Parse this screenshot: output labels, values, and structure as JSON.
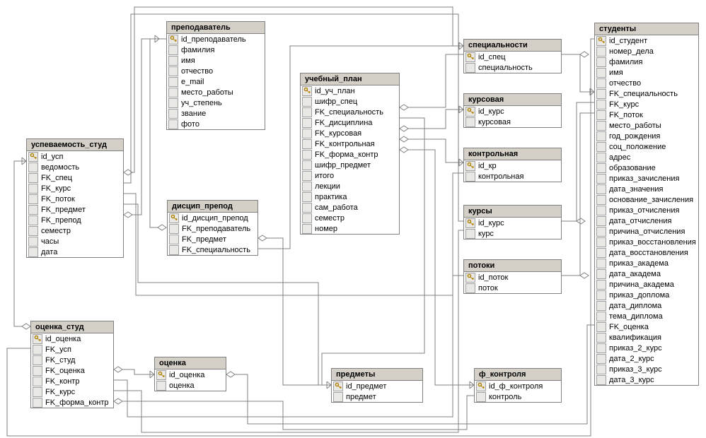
{
  "tables": {
    "uspevaemost": {
      "title": "успеваемость_студ",
      "fields": [
        {
          "name": "id_усп",
          "pk": true
        },
        {
          "name": "ведомость"
        },
        {
          "name": "FK_спец"
        },
        {
          "name": "FK_курс"
        },
        {
          "name": "FK_поток"
        },
        {
          "name": "FK_предмет"
        },
        {
          "name": "FK_препод"
        },
        {
          "name": "семестр"
        },
        {
          "name": "часы"
        },
        {
          "name": "дата"
        }
      ]
    },
    "prepod": {
      "title": "преподаватель",
      "fields": [
        {
          "name": "id_преподаватель",
          "pk": true
        },
        {
          "name": "фамилия"
        },
        {
          "name": "имя"
        },
        {
          "name": "отчество"
        },
        {
          "name": "e_mail"
        },
        {
          "name": "место_работы"
        },
        {
          "name": "уч_степень"
        },
        {
          "name": "звание"
        },
        {
          "name": "фото"
        }
      ]
    },
    "discip_prepod": {
      "title": "дисцип_препод",
      "fields": [
        {
          "name": "id_дисцип_препод",
          "pk": true
        },
        {
          "name": "FK_преподаватель"
        },
        {
          "name": "FK_предмет"
        },
        {
          "name": "FK_специальность"
        }
      ]
    },
    "ocenka_stud": {
      "title": "оценка_студ",
      "fields": [
        {
          "name": "id_оценка",
          "pk": true
        },
        {
          "name": "FK_усп"
        },
        {
          "name": "FK_студ"
        },
        {
          "name": "FK_оценка"
        },
        {
          "name": "FK_контр"
        },
        {
          "name": "FK_курс"
        },
        {
          "name": "FK_форма_контр"
        }
      ]
    },
    "ocenka": {
      "title": "оценка",
      "fields": [
        {
          "name": "id_оценка",
          "pk": true
        },
        {
          "name": "оценка"
        }
      ]
    },
    "uch_plan": {
      "title": "учебный_план",
      "fields": [
        {
          "name": "id_уч_план",
          "pk": true
        },
        {
          "name": "шифр_спец"
        },
        {
          "name": "FK_специальность"
        },
        {
          "name": "FK_дисциплина"
        },
        {
          "name": "FK_курсовая"
        },
        {
          "name": "FK_контрольная"
        },
        {
          "name": "FK_форма_контр"
        },
        {
          "name": "шифр_предмет"
        },
        {
          "name": "итого"
        },
        {
          "name": "лекции"
        },
        {
          "name": "практика"
        },
        {
          "name": "сам_работа"
        },
        {
          "name": "семестр"
        },
        {
          "name": "номер"
        }
      ]
    },
    "special": {
      "title": "специальности",
      "fields": [
        {
          "name": "id_спец",
          "pk": true
        },
        {
          "name": "специальность"
        }
      ]
    },
    "kursovaya": {
      "title": "курсовая",
      "fields": [
        {
          "name": "id_курс",
          "pk": true
        },
        {
          "name": "курсовая"
        }
      ]
    },
    "kontrolnaya": {
      "title": "контрольная",
      "fields": [
        {
          "name": "id_кр",
          "pk": true
        },
        {
          "name": "контрольная"
        }
      ]
    },
    "kursy": {
      "title": "курсы",
      "fields": [
        {
          "name": "id_курс",
          "pk": true
        },
        {
          "name": "курс"
        }
      ]
    },
    "potoki": {
      "title": "потоки",
      "fields": [
        {
          "name": "id_поток",
          "pk": true
        },
        {
          "name": "поток"
        }
      ]
    },
    "predmety": {
      "title": "предметы",
      "fields": [
        {
          "name": "id_предмет",
          "pk": true
        },
        {
          "name": "предмет"
        }
      ]
    },
    "f_kontrolya": {
      "title": "ф_контроля",
      "fields": [
        {
          "name": "id_ф_контроля",
          "pk": true
        },
        {
          "name": "контроль"
        }
      ]
    },
    "studenty": {
      "title": "студенты",
      "fields": [
        {
          "name": "id_студент",
          "pk": true
        },
        {
          "name": "номер_дела"
        },
        {
          "name": "фамилия"
        },
        {
          "name": "имя"
        },
        {
          "name": "отчество"
        },
        {
          "name": "FK_специальность"
        },
        {
          "name": "FK_курс"
        },
        {
          "name": "FK_поток"
        },
        {
          "name": "место_работы"
        },
        {
          "name": "год_рождения"
        },
        {
          "name": "соц_положение"
        },
        {
          "name": "адрес"
        },
        {
          "name": "образование"
        },
        {
          "name": "приказ_зачисления"
        },
        {
          "name": "дата_значения"
        },
        {
          "name": "основание_зачисления"
        },
        {
          "name": "приказ_отчисления"
        },
        {
          "name": "дата_отчисления"
        },
        {
          "name": "причина_отчисления"
        },
        {
          "name": "приказ_восстановления"
        },
        {
          "name": "дата_восстановления"
        },
        {
          "name": "приказ_академа"
        },
        {
          "name": "дата_академа"
        },
        {
          "name": "причина_академа"
        },
        {
          "name": "приказ_доплома"
        },
        {
          "name": "дата_диплома"
        },
        {
          "name": "тема_диплома"
        },
        {
          "name": "FK_оценка"
        },
        {
          "name": "квалификация"
        },
        {
          "name": "приказ_2_курс"
        },
        {
          "name": "дата_2_курс"
        },
        {
          "name": "приказ_3_курс"
        },
        {
          "name": "дата_3_курс"
        }
      ]
    }
  }
}
